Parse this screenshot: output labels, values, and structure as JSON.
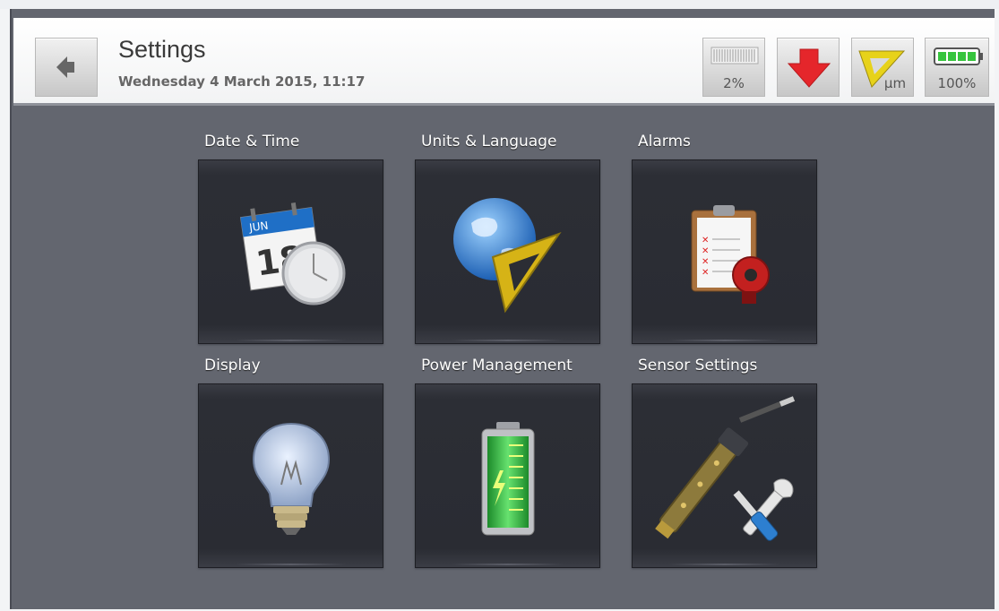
{
  "header": {
    "title": "Settings",
    "datetime": "Wednesday 4 March 2015, 11:17"
  },
  "status": {
    "memory_percent": "2%",
    "units_label": "µm",
    "battery_percent": "100%",
    "download_color": "#e5262b",
    "units_color": "#e7d21a",
    "battery_color": "#36c43d"
  },
  "tiles": [
    {
      "label": "Date & Time",
      "icon": "calendar-clock-icon",
      "calendar_month": "JUN",
      "calendar_day": "18"
    },
    {
      "label": "Units & Language",
      "icon": "globe-ruler-icon"
    },
    {
      "label": "Alarms",
      "icon": "clipboard-alarm-bell-icon"
    },
    {
      "label": "Display",
      "icon": "light-bulb-icon"
    },
    {
      "label": "Power Management",
      "icon": "battery-charging-icon"
    },
    {
      "label": "Sensor Settings",
      "icon": "sensor-tools-icon"
    }
  ]
}
